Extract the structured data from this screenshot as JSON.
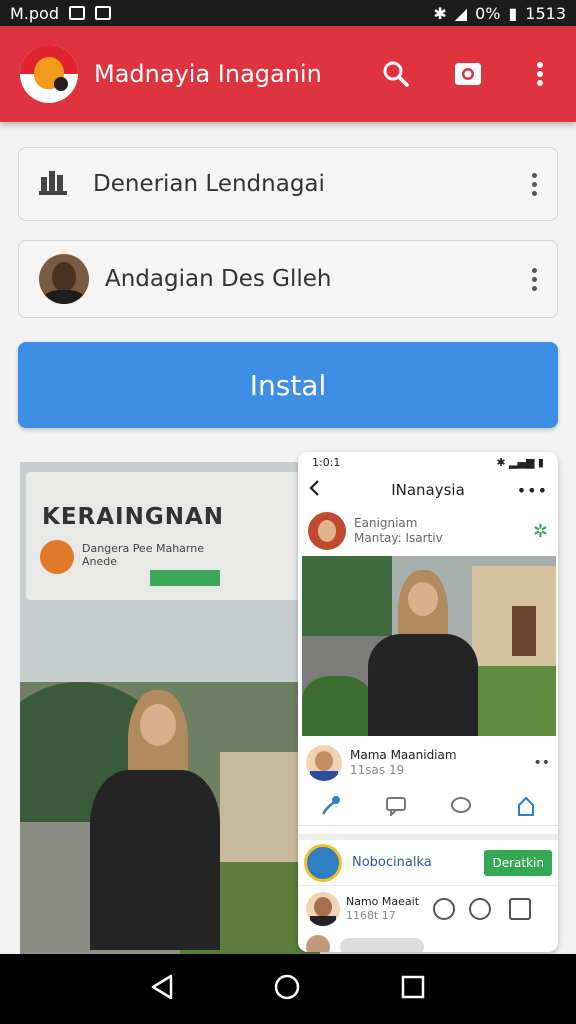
{
  "status_bar": {
    "carrier": "M.pod",
    "battery_percent": "0%",
    "time": "1513"
  },
  "app_bar": {
    "title": "Madnayia Inaganin",
    "actions": [
      "search-icon",
      "camera-icon",
      "more-vert-icon"
    ],
    "color": "#df3340"
  },
  "cards": [
    {
      "label": "Denerian Lendnagai",
      "icon": "bar-chart-icon"
    },
    {
      "label": "Andagian Des Glleh",
      "icon": "avatar"
    }
  ],
  "install_button": {
    "label": "Instal",
    "color": "#3f8ee6"
  },
  "screenshot_left": {
    "sign_title": "KERAINGNAN",
    "sign_text": "Dangera Pee Maharne\nAnede"
  },
  "phone_preview": {
    "time": "1:0:1",
    "header_title": "INanaysia",
    "post": {
      "name": "Eanigniam",
      "subtitle": "Mantay: Isartiv"
    },
    "comment": {
      "name": "Mama Maanidiam",
      "subtitle": "11sas 19"
    },
    "sheet": {
      "name": "Nobocinalka",
      "button_label": "Deratkin",
      "user_name": "Namo Maeait",
      "user_sub": "1168t 17"
    }
  }
}
